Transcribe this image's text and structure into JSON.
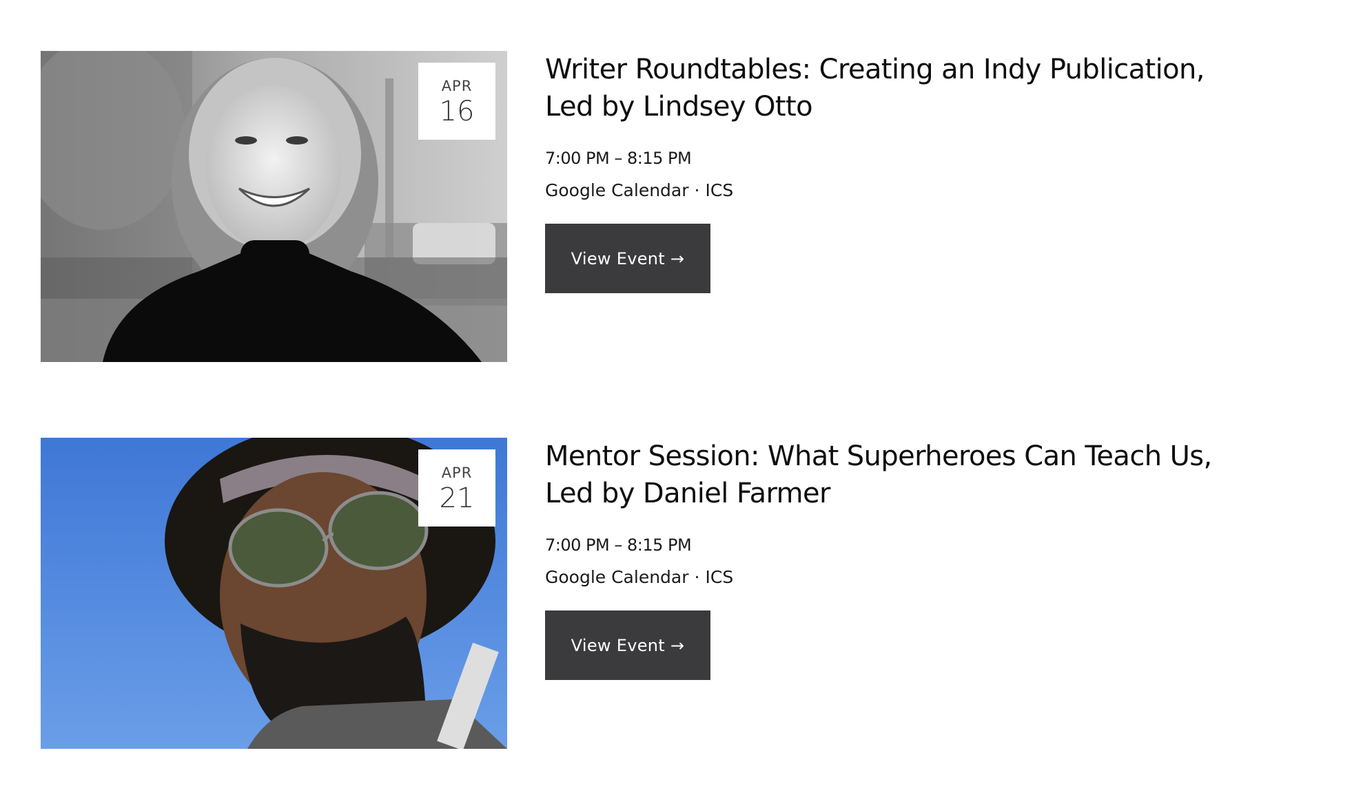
{
  "events": [
    {
      "month": "APR",
      "day": "16",
      "title_line1": "Writer Roundtables: Creating an Indy Publication,",
      "title_line2": "Led by Lindsey Otto",
      "time": "7:00 PM – 8:15 PM",
      "google_calendar": "Google Calendar",
      "separator": "·",
      "ics": "ICS",
      "button_label": "View Event →"
    },
    {
      "month": "APR",
      "day": "21",
      "title_line1": "Mentor Session: What Superheroes Can Teach Us,",
      "title_line2": "Led by Daniel Farmer",
      "time": "7:00 PM – 8:15 PM",
      "google_calendar": "Google Calendar",
      "separator": "·",
      "ics": "ICS",
      "button_label": "View Event →"
    }
  ],
  "colors": {
    "button_bg": "#3b3b3d",
    "button_text": "#ffffff",
    "title_text": "#0d0d0d",
    "photo2_sky": "#4f86de"
  }
}
